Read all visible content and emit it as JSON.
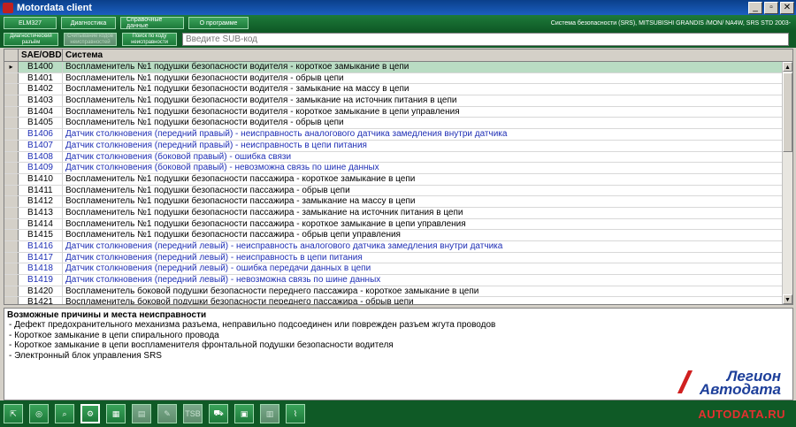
{
  "window": {
    "title": "Motordata client"
  },
  "menu": {
    "items": [
      "ELM327",
      "Диагностика",
      "Справочные данные",
      "О программе"
    ],
    "system_info": "Система безопасности (SRS), MITSUBISHI GRANDIS /MON/ NA4W, SRS STD 2003-"
  },
  "toolbar": {
    "btn1": "Диагностический разъём",
    "btn2": "Считывание кодов неисправностей",
    "btn3": "Поиск по коду неисправности",
    "search_placeholder": "Введите SUB-код"
  },
  "table": {
    "headers": {
      "code": "SAE/OBD",
      "system": "Система"
    },
    "rows": [
      {
        "code": "B1400",
        "text": "Воспламенитель №1 подушки безопасности водителя - короткое замыкание в цепи"
      },
      {
        "code": "B1401",
        "text": "Воспламенитель №1 подушки безопасности водителя - обрыв цепи"
      },
      {
        "code": "B1402",
        "text": "Воспламенитель №1 подушки безопасности водителя - замыкание на массу в цепи"
      },
      {
        "code": "B1403",
        "text": "Воспламенитель №1 подушки безопасности водителя - замыкание на источник питания в цепи"
      },
      {
        "code": "B1404",
        "text": "Воспламенитель №1 подушки безопасности водителя - короткое замыкание в цепи управления"
      },
      {
        "code": "B1405",
        "text": "Воспламенитель №1 подушки безопасности водителя - обрыв цепи"
      },
      {
        "code": "B1406",
        "text": "Датчик столкновения (передний правый) - неисправность аналогового датчика замедления внутри датчика"
      },
      {
        "code": "B1407",
        "text": "Датчик столкновения (передний правый) - неисправность в цепи питания"
      },
      {
        "code": "B1408",
        "text": "Датчик столкновения (боковой правый) - ошибка связи"
      },
      {
        "code": "B1409",
        "text": "Датчик столкновения (боковой правый) - невозможна связь по шине данных"
      },
      {
        "code": "B1410",
        "text": "Воспламенитель №1 подушки безопасности пассажира - короткое замыкание в цепи"
      },
      {
        "code": "B1411",
        "text": "Воспламенитель №1 подушки безопасности пассажира - обрыв цепи"
      },
      {
        "code": "B1412",
        "text": "Воспламенитель №1 подушки безопасности пассажира - замыкание на массу в цепи"
      },
      {
        "code": "B1413",
        "text": "Воспламенитель №1 подушки безопасности пассажира - замыкание на источник питания в цепи"
      },
      {
        "code": "B1414",
        "text": "Воспламенитель №1 подушки безопасности пассажира - короткое замыкание в цепи управления"
      },
      {
        "code": "B1415",
        "text": "Воспламенитель №1 подушки безопасности пассажира - обрыв цепи управления"
      },
      {
        "code": "B1416",
        "text": "Датчик столкновения (передний левый) - неисправность аналогового датчика замедления внутри датчика"
      },
      {
        "code": "B1417",
        "text": "Датчик столкновения (передний левый) - неисправность в цепи питания"
      },
      {
        "code": "B1418",
        "text": "Датчик столкновения (передний левый) - ошибка передачи данных в цепи"
      },
      {
        "code": "B1419",
        "text": "Датчик столкновения (передний левый) - невозможна связь по шине данных"
      },
      {
        "code": "B1420",
        "text": "Воспламенитель боковой подушки безопасности переднего пассажира - короткое замыкание в цепи"
      },
      {
        "code": "B1421",
        "text": "Воспламенитель боковой подушки безопасности переднего пассажира - обрыв цепи"
      }
    ]
  },
  "causes": {
    "title": "Возможные причины и места неисправности",
    "items": [
      "- Дефект предохранительного механизма разъема, неправильно подсоединен или поврежден разъем жгута проводов",
      "- Короткое замыкание в цепи спирального провода",
      "- Короткое замыкание в цепи воспламенителя фронтальной подушки безопасности водителя",
      "- Электронный блок управления SRS"
    ]
  },
  "logo": {
    "line1": "Легион",
    "line2": "Автодата"
  },
  "footer": {
    "site": "AUTODATA.RU",
    "tsb_label": "TSB"
  },
  "colors": {
    "accent_green": "#0f5a26",
    "selected_row": "#b9dcc3",
    "blue_text": "#1f2fb5",
    "logo_blue": "#1d3f9a",
    "logo_red": "#d02020"
  }
}
